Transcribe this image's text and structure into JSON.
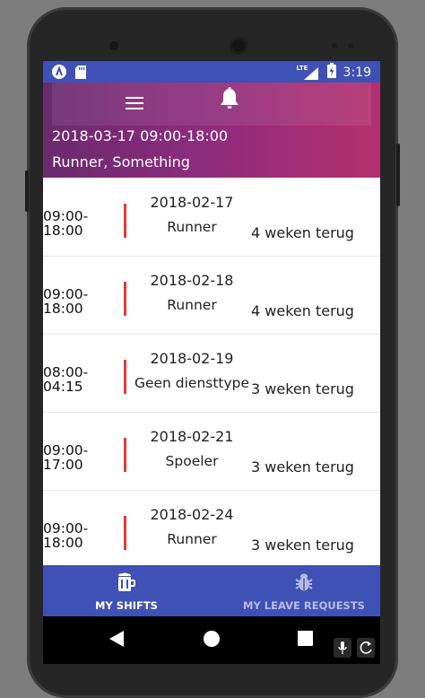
{
  "statusbar": {
    "network": "LTE",
    "time": "3:19"
  },
  "header": {
    "current_shift": "2018-03-17 09:00-18:00",
    "role_name": "Runner, Something"
  },
  "shifts": [
    {
      "time": "09:00-18:00",
      "date": "2018-02-17",
      "role": "Runner",
      "ago": "4 weken terug"
    },
    {
      "time": "09:00-18:00",
      "date": "2018-02-18",
      "role": "Runner",
      "ago": "4 weken terug"
    },
    {
      "time": "08:00-04:15",
      "date": "2018-02-19",
      "role": "Geen diensttype",
      "ago": "3 weken terug"
    },
    {
      "time": "09:00-17:00",
      "date": "2018-02-21",
      "role": "Spoeler",
      "ago": "3 weken terug"
    },
    {
      "time": "09:00-18:00",
      "date": "2018-02-24",
      "role": "Runner",
      "ago": "3 weken terug"
    }
  ],
  "bottom_nav": {
    "shifts_label": "MY SHIFTS",
    "leave_label": "MY LEAVE REQUESTS"
  },
  "colors": {
    "primary": "#3F51B5",
    "accent_bar": "#e53935",
    "inactive_nav": "#b7bde8"
  },
  "icons": {
    "statusbar_left": [
      "app-logo-icon",
      "sd-card-icon"
    ],
    "statusbar_right": [
      "signal-icon",
      "battery-charging-icon"
    ],
    "header": [
      "menu-icon",
      "bell-icon"
    ],
    "bottom_nav": [
      "beer-icon",
      "bug-icon"
    ],
    "system_nav": [
      "back-icon",
      "home-icon",
      "recents-icon",
      "mic-icon",
      "rotate-icon"
    ]
  }
}
